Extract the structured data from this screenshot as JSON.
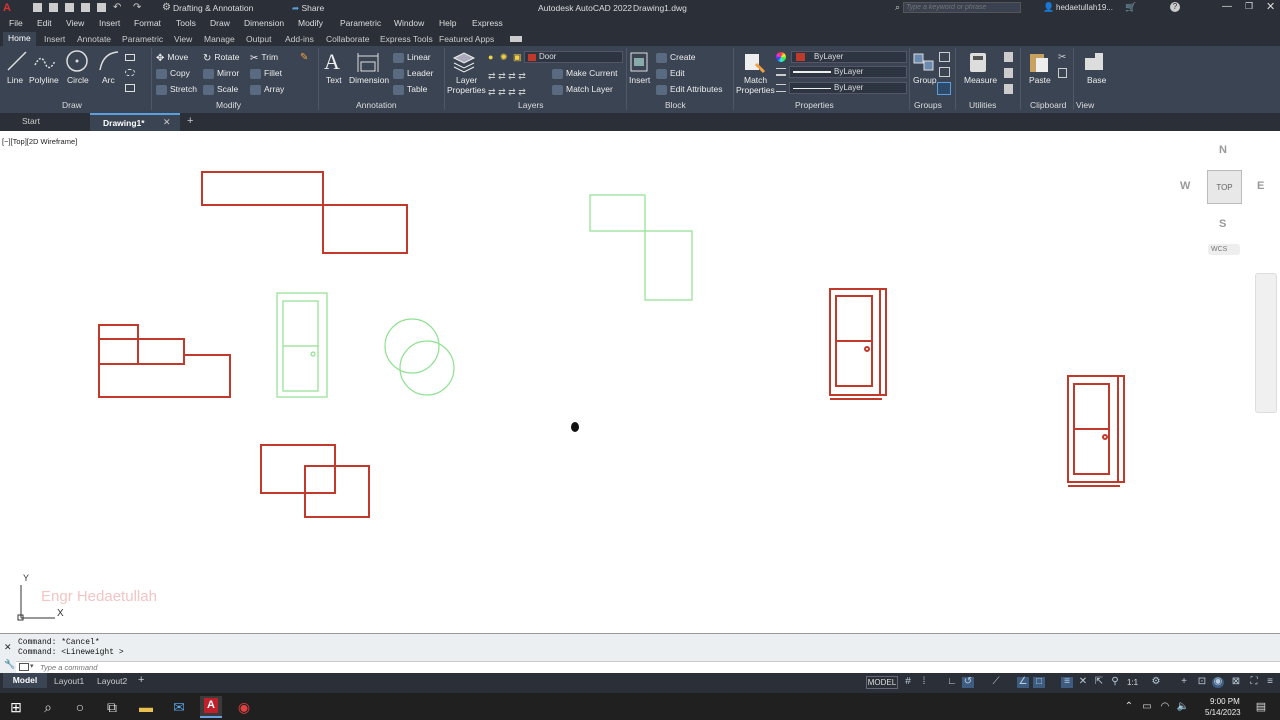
{
  "title_bar": {
    "workspace": "Drafting & Annotation",
    "share": "Share",
    "app_title": "Autodesk AutoCAD 2022",
    "doc_title": "Drawing1.dwg",
    "search_placeholder": "Type a keyword or phrase",
    "user": "hedaetullah19..."
  },
  "menu": [
    "File",
    "Edit",
    "View",
    "Insert",
    "Format",
    "Tools",
    "Draw",
    "Dimension",
    "Modify",
    "Parametric",
    "Window",
    "Help",
    "Express"
  ],
  "ribbon_tabs": [
    "Home",
    "Insert",
    "Annotate",
    "Parametric",
    "View",
    "Manage",
    "Output",
    "Add-ins",
    "Collaborate",
    "Express Tools",
    "Featured Apps"
  ],
  "draw_panel": {
    "line": "Line",
    "polyline": "Polyline",
    "circle": "Circle",
    "arc": "Arc",
    "label": "Draw"
  },
  "modify_panel": {
    "move": "Move",
    "rotate": "Rotate",
    "trim": "Trim",
    "copy": "Copy",
    "mirror": "Mirror",
    "fillet": "Fillet",
    "stretch": "Stretch",
    "scale": "Scale",
    "array": "Array",
    "label": "Modify"
  },
  "annotation_panel": {
    "text": "Text",
    "dimension": "Dimension",
    "linear": "Linear",
    "leader": "Leader",
    "table": "Table",
    "label": "Annotation"
  },
  "layers_panel": {
    "layer_properties_1": "Layer",
    "layer_properties_2": "Properties",
    "current_layer": "Door",
    "make_current": "Make Current",
    "match_layer": "Match Layer",
    "label": "Layers"
  },
  "block_panel": {
    "insert": "Insert",
    "create": "Create",
    "edit": "Edit",
    "edit_attributes": "Edit Attributes",
    "label": "Block"
  },
  "properties_panel": {
    "match_1": "Match",
    "match_2": "Properties",
    "color": "ByLayer",
    "lineweight": "ByLayer",
    "linetype": "ByLayer",
    "label": "Properties"
  },
  "groups_panel": {
    "group": "Group",
    "label": "Groups"
  },
  "utilities_panel": {
    "measure": "Measure",
    "label": "Utilities"
  },
  "clipboard_panel": {
    "paste": "Paste",
    "label": "Clipboard"
  },
  "view_panel": {
    "base": "Base",
    "label": "View"
  },
  "file_tabs": {
    "start": "Start",
    "drawing": "Drawing1*"
  },
  "viewport_label": "[−][Top][2D Wireframe]",
  "viewcube": {
    "n": "N",
    "s": "S",
    "e": "E",
    "w": "W",
    "top": "TOP",
    "wcs": "WCS"
  },
  "ucs": {
    "x": "X",
    "y": "Y"
  },
  "watermark": "Engr Hedaetullah",
  "command_history": [
    "Command: *Cancel*",
    "Command:  <Lineweight >"
  ],
  "command_placeholder": "Type a command",
  "layout_tabs": [
    "Model",
    "Layout1",
    "Layout2"
  ],
  "status": {
    "model": "MODEL",
    "scale": "1:1"
  },
  "clock": {
    "time": "9:00 PM",
    "date": "5/14/2023"
  },
  "colors": {
    "door_layer": "#c0392b",
    "green_layer": "#8fe08f",
    "ribbon_bg": "#3b4453",
    "title_bg": "#2b3038"
  },
  "icons": [
    "autocad-logo-icon",
    "save-icon",
    "undo-icon",
    "redo-icon",
    "search-icon",
    "user-icon",
    "cart-icon",
    "help-icon",
    "minimize-icon",
    "restore-icon",
    "close-icon",
    "windows-start-icon",
    "taskbar-search-icon",
    "cortana-icon",
    "task-view-icon",
    "file-explorer-icon",
    "mail-icon",
    "autocad-taskbar-icon",
    "chrome-icon",
    "hand-pan-cursor-icon"
  ]
}
